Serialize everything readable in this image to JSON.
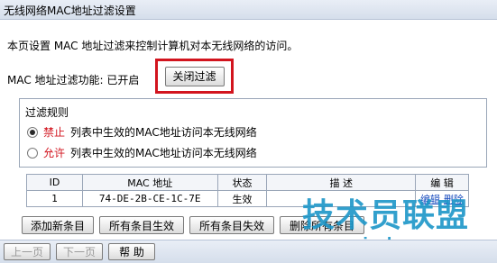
{
  "header": {
    "title": "无线网络MAC地址过滤设置"
  },
  "description": "本页设置 MAC 地址过滤来控制计算机对本无线网络的访问。",
  "filter": {
    "label": "MAC 地址过滤功能: 已开启",
    "toggle_label": "关闭过滤"
  },
  "rules": {
    "title": "过滤规则",
    "options": [
      {
        "keyword": "禁止",
        "text": "列表中生效的MAC地址访问本无线网络",
        "checked": true
      },
      {
        "keyword": "允许",
        "text": "列表中生效的MAC地址访问本无线网络",
        "checked": false
      }
    ]
  },
  "table": {
    "headers": [
      "ID",
      "MAC 地址",
      "状态",
      "描  述",
      "编 辑"
    ],
    "rows": [
      {
        "id": "1",
        "mac": "74-DE-2B-CE-1C-7E",
        "status": "生效",
        "desc": "",
        "edit": "编辑",
        "delete": "删除"
      }
    ]
  },
  "actions": {
    "add": "添加新条目",
    "enable_all": "所有条目生效",
    "disable_all": "所有条目失效",
    "delete_all": "删除所有条目"
  },
  "footer": {
    "prev": "上一页",
    "next": "下一页",
    "help": "帮 助"
  },
  "watermark": {
    "title": "技术员联盟",
    "url": "www.jsgho.com"
  },
  "colors": {
    "highlight_border": "#d2141e",
    "keyword": "#d2141e",
    "watermark": "#1c96c8",
    "link": "#1a4dbf"
  }
}
